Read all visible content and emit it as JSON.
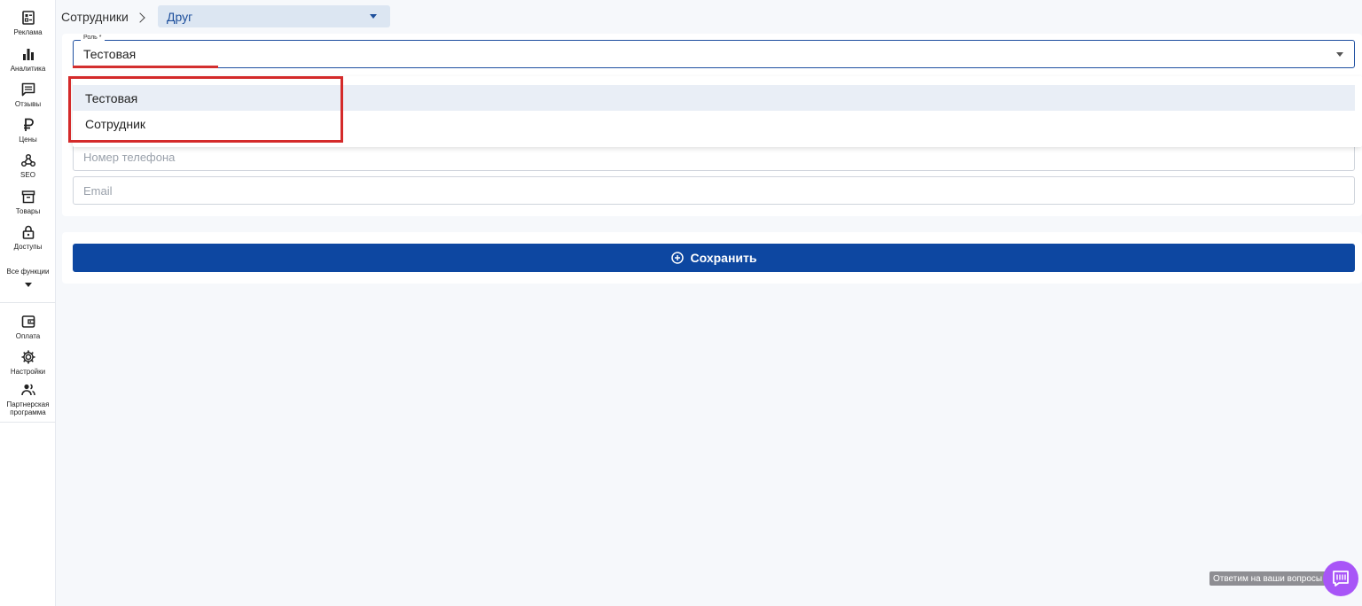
{
  "sidebar": {
    "items": [
      {
        "label": "Реклама",
        "icon": "ads-icon"
      },
      {
        "label": "Аналитика",
        "icon": "bar-chart-icon"
      },
      {
        "label": "Отзывы",
        "icon": "comment-icon"
      },
      {
        "label": "Цены",
        "icon": "ruble-icon"
      },
      {
        "label": "SEO",
        "icon": "webhook-icon"
      },
      {
        "label": "Товары",
        "icon": "archive-icon"
      },
      {
        "label": "Доступы",
        "icon": "lock-icon"
      }
    ],
    "all_functions_label": "Все функции",
    "bottom_items": [
      {
        "label": "Оплата",
        "icon": "wallet-icon"
      },
      {
        "label": "Настройки",
        "icon": "gear-icon"
      },
      {
        "label": "Партнерская программа",
        "icon": "partners-icon"
      }
    ]
  },
  "breadcrumb": {
    "parent": "Сотрудники",
    "current_select": "Друг"
  },
  "form": {
    "role_label": "Роль *",
    "role_value": "Тестовая",
    "role_options": [
      "Тестовая",
      "Сотрудник"
    ],
    "phone_placeholder": "Номер телефона",
    "email_placeholder": "Email",
    "save_label": "Сохранить"
  },
  "chat": {
    "tooltip": "Ответим на ваши вопросы"
  },
  "colors": {
    "primary": "#0d47a1",
    "highlight": "#d42a2a",
    "chat": "#a855f7"
  }
}
